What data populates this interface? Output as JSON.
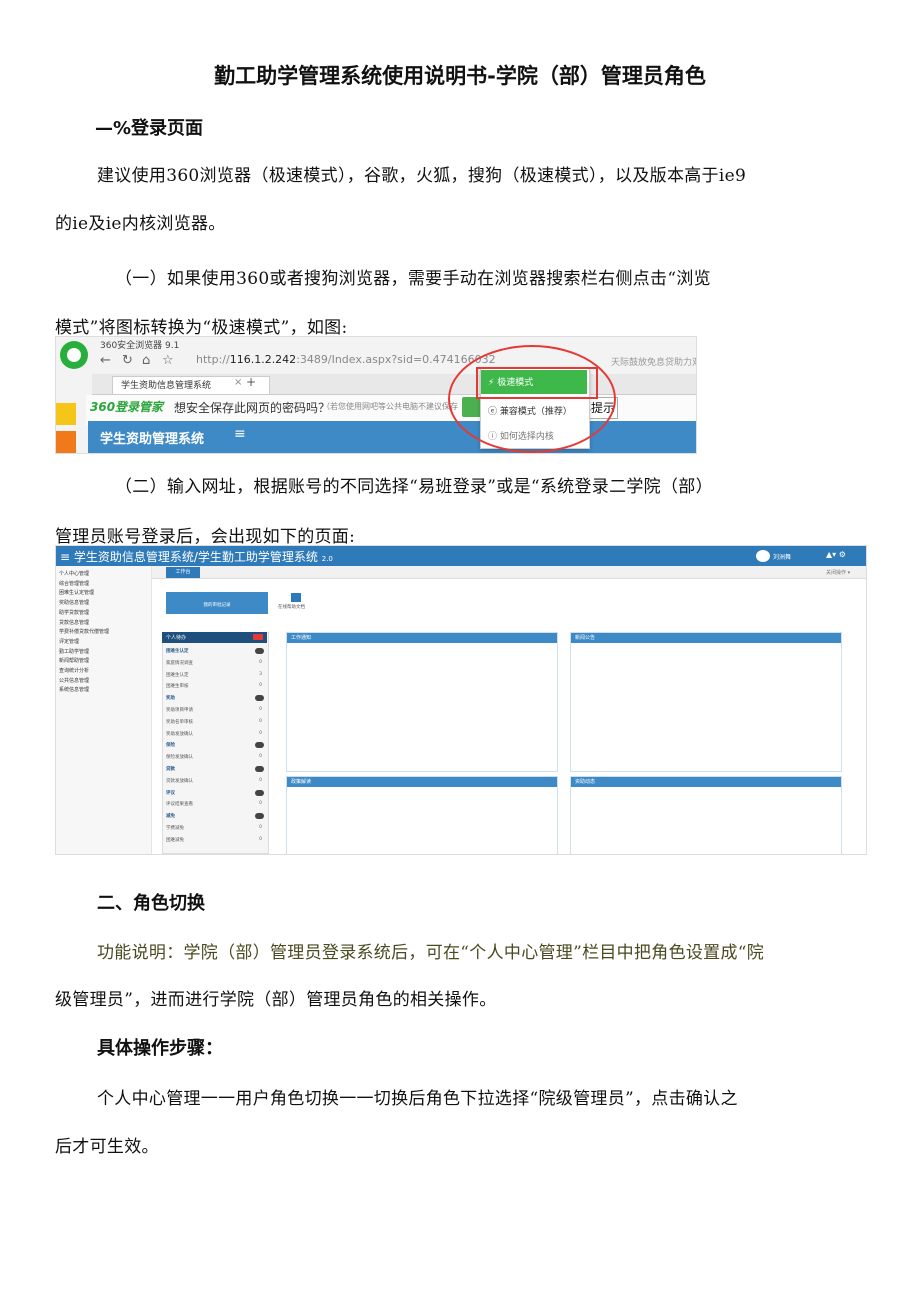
{
  "doc": {
    "title": "勤工助学管理系统使用说明书-学院（部）管理员角色",
    "section1_heading": "—%登录页面",
    "para1_line1": "建议使用360浏览器（极速模式），谷歌，火狐，搜狗（极速模式），以及版本高于ie9",
    "para1_line2": "的ie及ie内核浏览器。",
    "para2_line1": "（一）如果使用360或者搜狗浏览器，需要手动在浏览器搜索栏右侧点击“浏览",
    "para2_line2": "模式”将图标转换为“极速模式”，如图:",
    "para3_line1": "（二）输入网址，根据账号的不同选择“易班登录”或是“系统登录二学院（部）",
    "para3_line2": "管理员账号登录后，会出现如下的页面:",
    "section2_heading": "二、角色切换",
    "para4_line1": "功能说明：学院（部）管理员登录系统后，可在“个人中心管理”栏目中把角色设置成“院",
    "para4_line2": "级管理员”，进而进行学院（部）管理员角色的相关操作。",
    "steps_heading": "具体操作步骤：",
    "para5_line1": "个人中心管理一一用户角色切换一一切换后角色下拉选择“院级管理员”，点击确认之",
    "para5_line2": "后才可生效。"
  },
  "browser_shot": {
    "app_title": "360安全浏览器 9.1",
    "url_host": "116.1.2.242",
    "url_rest": ":3489/Index.aspx?sid=0.47416603273215965",
    "right_text": "天际鼓放免息贷助力双十一",
    "tab_title": "学生资助信息管理系统",
    "brand": "360登录管家",
    "save_prompt": "想安全保存此网页的密码吗？",
    "save_note": "（若您使用网吧等公共电脑不建议保存",
    "hint_btn": "再提示",
    "app_name": "学生资助管理系统",
    "menu_icon": "≡",
    "dropdown": [
      "极速模式",
      "兼容模式（推荐）",
      "如何选择内核"
    ],
    "colors": {
      "accent": "#3d8ac6",
      "green": "#3fb84b",
      "highlight": "#e53935"
    }
  },
  "admin_shot": {
    "title": "≡  学生资助信息管理系统/学生勤工助学管理系统",
    "version": "2.0",
    "username": "刘洲舞",
    "top_icons": "▲▾  ⚙",
    "sidebar": [
      "个人中心管理",
      "综合管理管理",
      "困难生认定管理",
      "奖助信息管理",
      "助学贷款管理",
      "贷款信息管理",
      "学费补偿贷款代偿管理",
      "评定管理",
      "勤工助学管理",
      "新闻帮助管理",
      "查询统计分析",
      "公共信息管理",
      "系统信息管理"
    ],
    "work_tab": "工作台",
    "close_ops": "关闭操作 ▾",
    "tile_label": "我的审批记录",
    "rss_label": "在线帮助文档",
    "todo_title": "个人待办",
    "todo_rows": [
      {
        "label": "困难生认定",
        "cat": true
      },
      {
        "label": "家庭情况调查",
        "n": "0"
      },
      {
        "label": "困难生认定",
        "n": "3"
      },
      {
        "label": "困难生审核",
        "n": "0"
      },
      {
        "label": "奖助",
        "cat": true
      },
      {
        "label": "奖助项目申请",
        "n": "0"
      },
      {
        "label": "奖助名单审核",
        "n": "0"
      },
      {
        "label": "奖助发放确认",
        "n": "0"
      },
      {
        "label": "保险",
        "cat": true
      },
      {
        "label": "保险发放确认",
        "n": "0"
      },
      {
        "label": "贷款",
        "cat": true
      },
      {
        "label": "贷款发放确认",
        "n": "0"
      },
      {
        "label": "评议",
        "cat": true
      },
      {
        "label": "评议结果查看",
        "n": "0"
      },
      {
        "label": "减免",
        "cat": true
      },
      {
        "label": "学费减免",
        "n": "0"
      },
      {
        "label": "困难减免",
        "n": "0"
      }
    ],
    "panels": {
      "work": "工作通知",
      "news": "新闻公告",
      "policy": "政策解读",
      "dynamic": "资助动态"
    }
  }
}
